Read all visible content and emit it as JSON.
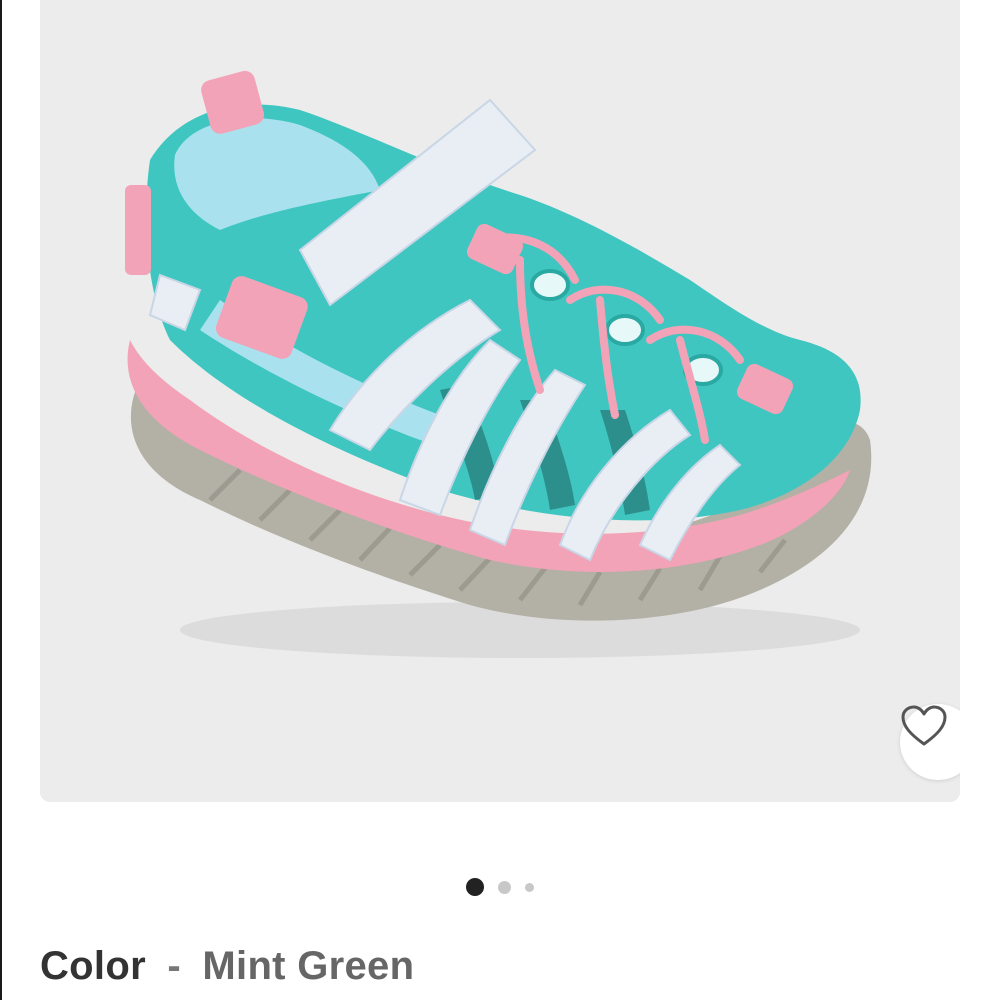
{
  "product": {
    "image_alt": "Toddler sandal in mint green with pink accents and iridescent straps",
    "favorite_icon": "heart-outline-icon"
  },
  "carousel": {
    "total": 3,
    "active_index": 0
  },
  "color_selector": {
    "label": "Color",
    "separator": "-",
    "value": "Mint Green"
  },
  "colors": {
    "card_background": "#ececec",
    "mint": "#3fc6c0",
    "pink": "#f2a3b7",
    "sole_gray": "#b3b0a5"
  }
}
